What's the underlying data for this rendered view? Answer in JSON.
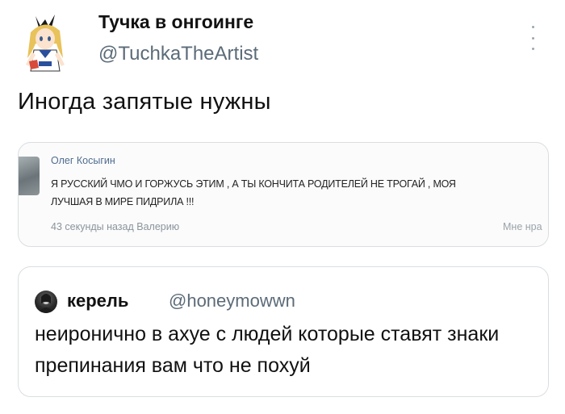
{
  "author": {
    "name": "Тучка в онгоинге",
    "handle": "@TuchkaTheArtist"
  },
  "tweet": {
    "text": "Иногда запятые нужны"
  },
  "embedded_post": {
    "author_name": "Олег Косыгин",
    "lines": [
      "Я РУССКИЙ ЧМО И ГОРЖУСЬ ЭТИМ , А ТЫ КОНЧИТА РОДИТЕЛЕЙ НЕ ТРОГАЙ , МОЯ",
      "ЛУЧШАЯ В МИРЕ ПИДРИЛА !!!"
    ],
    "meta": "43 секунды назад Валерию",
    "like_label": "Мне нра"
  },
  "quoted_tweet": {
    "name": "керель",
    "handle": "@honeymowwn",
    "text": "неиронично в ахуе с людей которые ставят знаки препинания вам что не похуй"
  }
}
